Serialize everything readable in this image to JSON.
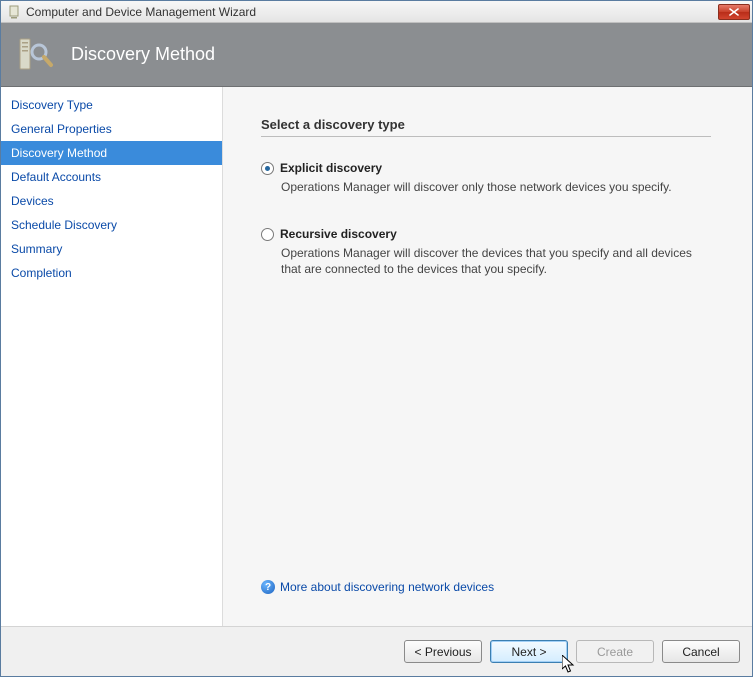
{
  "window": {
    "title": "Computer and Device Management Wizard"
  },
  "header": {
    "title": "Discovery Method"
  },
  "sidebar": {
    "items": [
      {
        "label": "Discovery Type",
        "active": false
      },
      {
        "label": "General Properties",
        "active": false
      },
      {
        "label": "Discovery Method",
        "active": true
      },
      {
        "label": "Default Accounts",
        "active": false
      },
      {
        "label": "Devices",
        "active": false
      },
      {
        "label": "Schedule Discovery",
        "active": false
      },
      {
        "label": "Summary",
        "active": false
      },
      {
        "label": "Completion",
        "active": false
      }
    ]
  },
  "content": {
    "heading": "Select a discovery type",
    "options": [
      {
        "id": "explicit",
        "label": "Explicit discovery",
        "description": "Operations Manager will discover only those network devices you specify.",
        "checked": true
      },
      {
        "id": "recursive",
        "label": "Recursive discovery",
        "description": "Operations Manager will discover the devices that you specify and all devices that are connected to the devices that you specify.",
        "checked": false
      }
    ],
    "help_link": "More about discovering network devices",
    "help_symbol": "?"
  },
  "footer": {
    "buttons": {
      "previous": "< Previous",
      "next": "Next >",
      "create": "Create",
      "cancel": "Cancel"
    }
  }
}
